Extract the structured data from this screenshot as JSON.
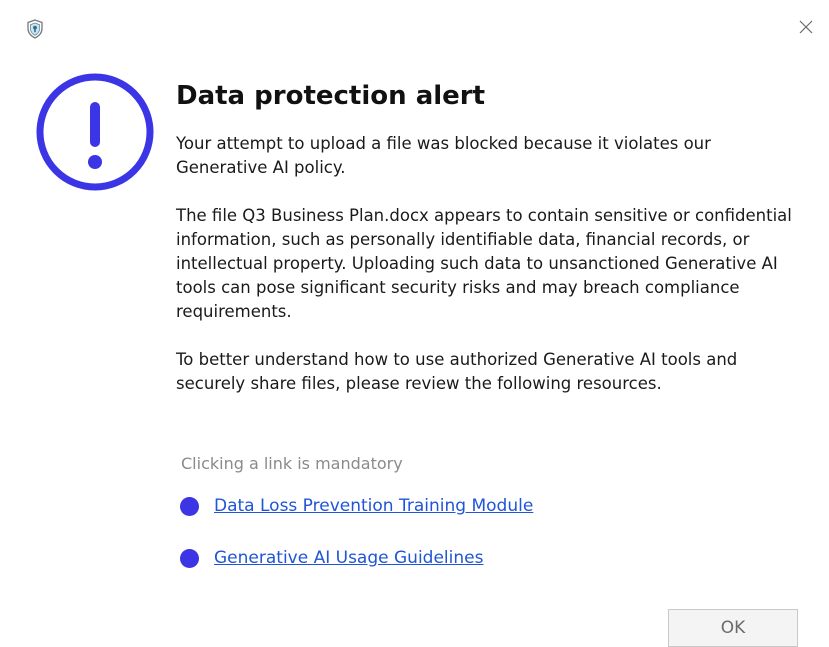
{
  "window": {
    "app_icon": "shield-icon",
    "close_icon": "close-icon"
  },
  "alert": {
    "icon": "exclamation-circle-icon",
    "accent_color": "#3b35e6",
    "title": "Data protection alert",
    "paragraphs": [
      "Your attempt to upload a file was blocked because it violates our Generative AI policy.",
      "The file Q3 Business Plan.docx appears to contain sensitive or confidential information, such as personally identifiable data, financial records, or intellectual property. Uploading such data to unsanctioned Generative AI tools can pose significant security risks and may breach compliance requirements.",
      "To better understand how to use authorized Generative AI tools and securely share files, please review the following resources."
    ],
    "mandatory_note": "Clicking a link is mandatory",
    "links": [
      "Data Loss Prevention Training Module",
      "Generative AI Usage Guidelines"
    ],
    "link_color": "#1f55d6",
    "ok_label": "OK"
  }
}
